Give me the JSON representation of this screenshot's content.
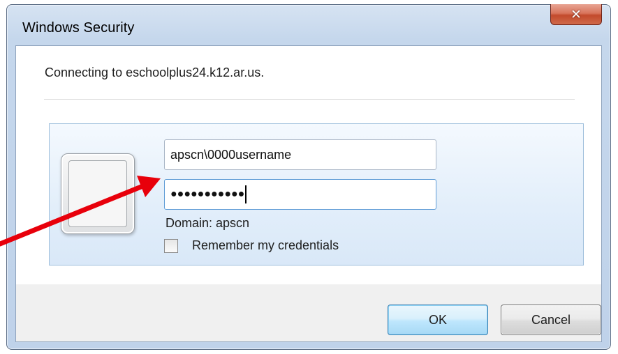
{
  "window": {
    "title": "Windows Security",
    "close_icon": "close-icon"
  },
  "message": {
    "connecting_text": "Connecting to eschoolplus24.k12.ar.us."
  },
  "credentials": {
    "avatar_icon": "user-tile-icon",
    "username_value": "apscn\\0000username",
    "password_value": "●●●●●●●●●●●",
    "domain_text": "Domain: apscn",
    "remember_label": "Remember my credentials",
    "remember_checked": false
  },
  "buttons": {
    "ok_label": "OK",
    "cancel_label": "Cancel"
  },
  "colors": {
    "annotation_arrow": "#e8000b",
    "ok_button_border": "#3c7fb1",
    "close_button": "#c9523a"
  }
}
